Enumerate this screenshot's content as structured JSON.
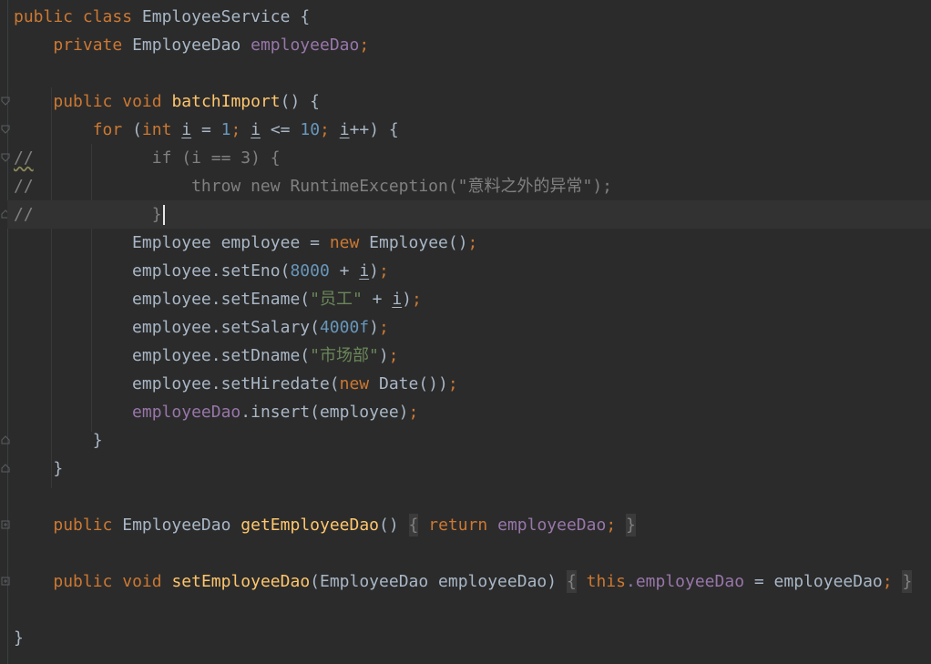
{
  "code": {
    "l1": {
      "public": "public",
      "class": "class",
      "name": "EmployeeService",
      "brace": "{"
    },
    "l2": {
      "private": "private",
      "type": "EmployeeDao",
      "field": "employeeDao",
      "semi": ";"
    },
    "l3": {
      "public": "public",
      "void": "void",
      "method": "batchImport",
      "rest": "() {"
    },
    "l4": {
      "for": "for",
      "p1": "(",
      "int": "int",
      "i1": "i",
      "eq": " = ",
      "n1": "1",
      "s1": "; ",
      "i2": "i",
      "le": " <= ",
      "n2": "10",
      "s2": "; ",
      "i3": "i",
      "pp": "++) {"
    },
    "l5": {
      "comment": "//",
      "code": "            if (i == 3) {"
    },
    "l6": {
      "comment": "//",
      "code": "                throw new RuntimeException(\"意料之外的异常\");"
    },
    "l7": {
      "comment": "//",
      "code": "            }"
    },
    "l8": {
      "type": "Employee",
      "var": "employee",
      "eq": " = ",
      "new": "new",
      "call": "Employee()",
      "semi": ";"
    },
    "l9": {
      "call": "employee.setEno(",
      "num": "8000",
      "plus": " + ",
      "i": "i",
      "close": ")",
      "semi": ";"
    },
    "l10": {
      "call": "employee.setEname(",
      "str": "\"员工\"",
      "plus": " + ",
      "i": "i",
      "close": ")",
      "semi": ";"
    },
    "l11": {
      "call": "employee.setSalary(",
      "num": "4000f",
      "close": ")",
      "semi": ";"
    },
    "l12": {
      "call": "employee.setDname(",
      "str": "\"市场部\"",
      "close": ")",
      "semi": ";"
    },
    "l13": {
      "call": "employee.setHiredate(",
      "new": "new",
      "rest": "Date())",
      "semi": ";"
    },
    "l14": {
      "field": "employeeDao",
      "call": ".insert(employee)",
      "semi": ";"
    },
    "l15": {
      "brace": "}"
    },
    "l16": {
      "brace": "}"
    },
    "l17": {
      "public": "public",
      "type": "EmployeeDao",
      "method": "getEmployeeDao",
      "parens": "()",
      "ob": "{",
      "return": "return",
      "field": "employeeDao",
      "semi": ";",
      "cb": "}"
    },
    "l18": {
      "public": "public",
      "void": "void",
      "method": "setEmployeeDao",
      "params": "(EmployeeDao employeeDao)",
      "ob": "{",
      "this": "this",
      "field": ".employeeDao",
      "assign": " = employeeDao",
      "semi": ";",
      "cb": "}"
    },
    "l19": {
      "brace": "}"
    }
  },
  "colors": {
    "background": "#2b2b2b",
    "keyword": "#cc7832",
    "method": "#ffc66d",
    "field": "#9876aa",
    "number": "#6897bb",
    "string": "#6a8759",
    "comment": "#808080",
    "text": "#a9b7c6"
  }
}
